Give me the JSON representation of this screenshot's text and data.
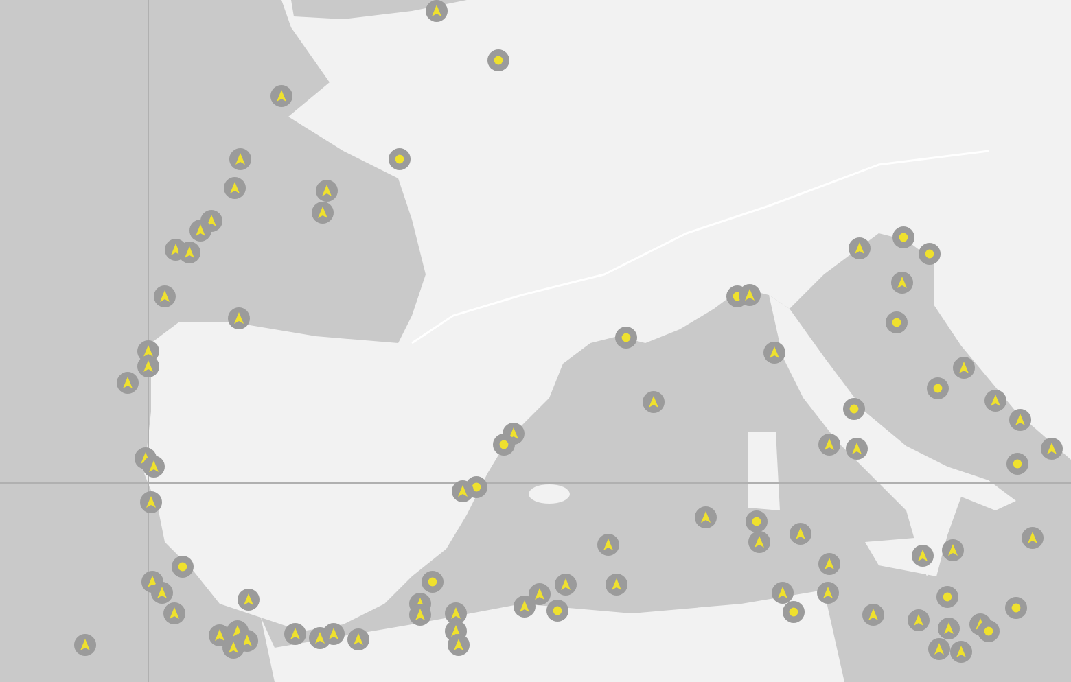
{
  "markers": [
    {
      "kind": "moving"
    },
    {
      "kind": "stopped"
    },
    {
      "kind": "moving"
    },
    {
      "kind": "stopped"
    },
    {
      "kind": "moving"
    },
    {
      "kind": "moving"
    },
    {
      "kind": "moving"
    },
    {
      "kind": "moving"
    },
    {
      "kind": "moving"
    },
    {
      "kind": "moving"
    },
    {
      "kind": "moving"
    },
    {
      "kind": "moving"
    },
    {
      "kind": "moving"
    },
    {
      "kind": "moving"
    },
    {
      "kind": "moving"
    },
    {
      "kind": "moving"
    },
    {
      "kind": "moving"
    },
    {
      "kind": "stopped"
    },
    {
      "kind": "stopped"
    },
    {
      "kind": "moving"
    },
    {
      "kind": "moving"
    },
    {
      "kind": "moving"
    },
    {
      "kind": "stopped"
    },
    {
      "kind": "stopped"
    },
    {
      "kind": "moving"
    },
    {
      "kind": "stopped"
    },
    {
      "kind": "moving"
    },
    {
      "kind": "stopped"
    },
    {
      "kind": "stopped"
    },
    {
      "kind": "moving"
    },
    {
      "kind": "moving"
    },
    {
      "kind": "moving"
    },
    {
      "kind": "stopped"
    },
    {
      "kind": "moving"
    },
    {
      "kind": "moving"
    },
    {
      "kind": "moving"
    },
    {
      "kind": "moving"
    },
    {
      "kind": "stopped"
    },
    {
      "kind": "stopped"
    },
    {
      "kind": "moving"
    },
    {
      "kind": "moving"
    },
    {
      "kind": "moving"
    },
    {
      "kind": "moving"
    },
    {
      "kind": "stopped"
    },
    {
      "kind": "moving"
    },
    {
      "kind": "moving"
    },
    {
      "kind": "moving"
    },
    {
      "kind": "moving"
    },
    {
      "kind": "moving"
    },
    {
      "kind": "moving"
    },
    {
      "kind": "moving"
    },
    {
      "kind": "moving"
    },
    {
      "kind": "moving"
    },
    {
      "kind": "moving"
    },
    {
      "kind": "moving"
    },
    {
      "kind": "moving"
    },
    {
      "kind": "moving"
    },
    {
      "kind": "moving"
    },
    {
      "kind": "stopped"
    },
    {
      "kind": "moving"
    },
    {
      "kind": "moving"
    },
    {
      "kind": "moving"
    },
    {
      "kind": "moving"
    },
    {
      "kind": "moving"
    },
    {
      "kind": "moving"
    },
    {
      "kind": "stopped"
    },
    {
      "kind": "moving"
    },
    {
      "kind": "moving"
    },
    {
      "kind": "moving"
    },
    {
      "kind": "stopped"
    },
    {
      "kind": "moving"
    },
    {
      "kind": "moving"
    },
    {
      "kind": "moving"
    },
    {
      "kind": "moving"
    },
    {
      "kind": "moving"
    },
    {
      "kind": "stopped"
    },
    {
      "kind": "moving"
    },
    {
      "kind": "moving"
    },
    {
      "kind": "moving"
    },
    {
      "kind": "stopped"
    },
    {
      "kind": "moving"
    },
    {
      "kind": "stopped"
    },
    {
      "kind": "moving"
    },
    {
      "kind": "moving"
    },
    {
      "kind": "moving"
    },
    {
      "kind": "stopped"
    },
    {
      "kind": "moving"
    },
    {
      "kind": "moving"
    },
    {
      "kind": "moving"
    }
  ]
}
